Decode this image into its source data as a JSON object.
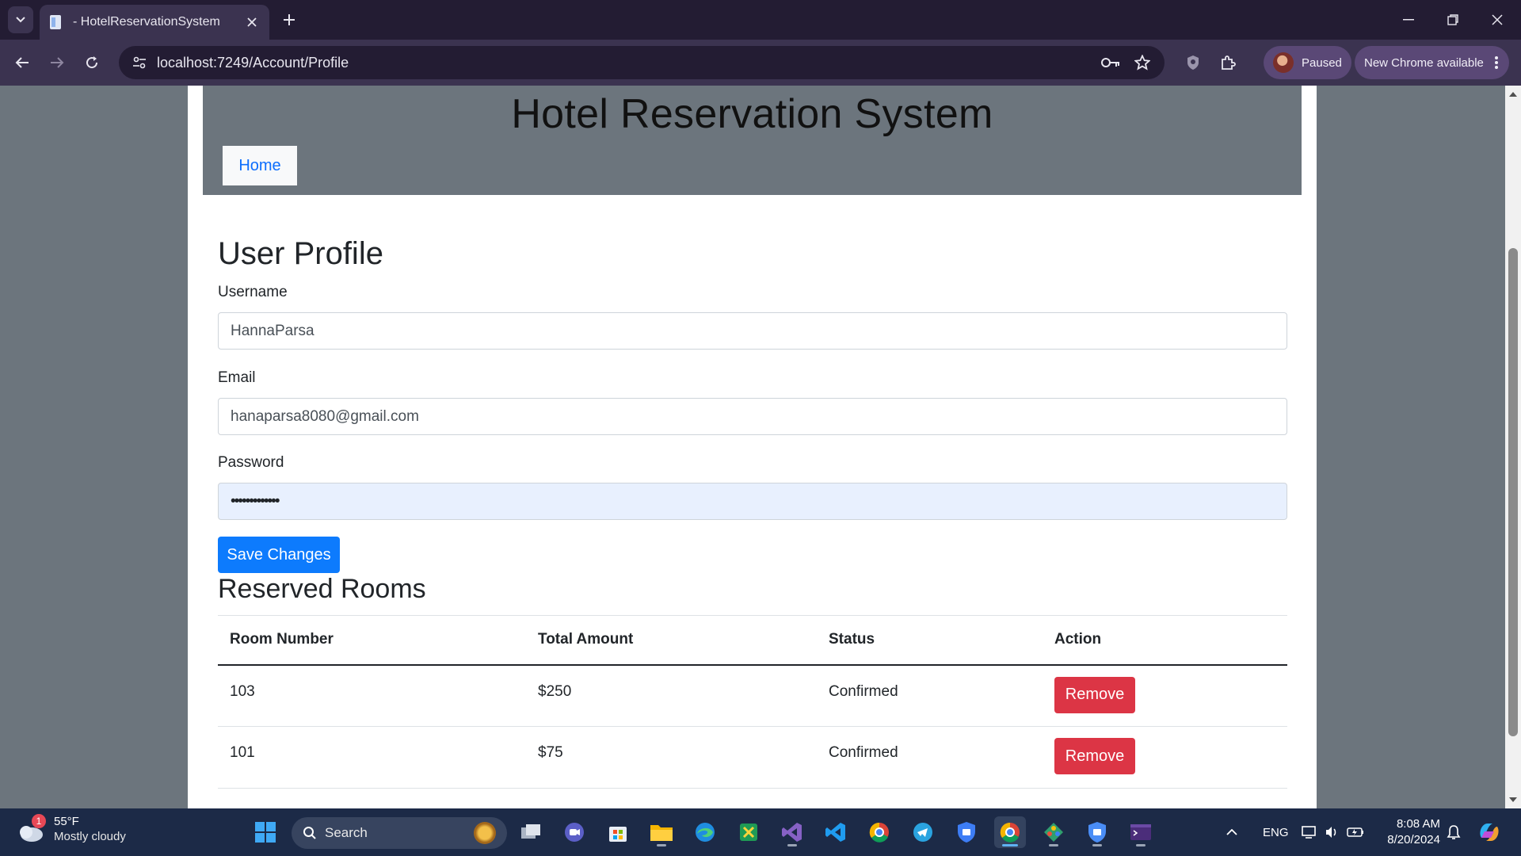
{
  "browser": {
    "tab": {
      "title": "- HotelReservationSystem"
    },
    "address_bar": {
      "url": "localhost:7249/Account/Profile"
    },
    "profile": {
      "status": "Paused"
    },
    "update_pill": {
      "label": "New Chrome available"
    }
  },
  "site": {
    "title": "Hotel Reservation System",
    "nav": {
      "home": "Home"
    }
  },
  "profile": {
    "heading": "User Profile",
    "username": {
      "label": "Username",
      "value": "HannaParsa"
    },
    "email": {
      "label": "Email",
      "value": "hanaparsa8080@gmail.com"
    },
    "password": {
      "label": "Password",
      "value": "•••••••••••••"
    },
    "save_label": "Save Changes"
  },
  "reservations": {
    "heading": "Reserved Rooms",
    "columns": [
      "Room Number",
      "Total Amount",
      "Status",
      "Action"
    ],
    "rows": [
      {
        "room": "103",
        "amount": "$250",
        "status": "Confirmed",
        "action": "Remove"
      },
      {
        "room": "101",
        "amount": "$75",
        "status": "Confirmed",
        "action": "Remove"
      }
    ]
  },
  "taskbar": {
    "weather": {
      "temp": "55°F",
      "condition": "Mostly cloudy",
      "badge": "1"
    },
    "search_placeholder": "Search",
    "language": "ENG",
    "time": "8:08 AM",
    "date": "8/20/2024",
    "apps": [
      "start-icon",
      "task-view-icon",
      "meet-icon",
      "store-icon",
      "file-explorer-icon",
      "edge-icon",
      "excel-app-icon",
      "visual-studio-icon",
      "vscode-icon",
      "chrome-icon",
      "telegram-icon",
      "vpn-shield-icon",
      "chrome-active-icon",
      "sourcetree-icon",
      "security-shield-icon",
      "terminal-icon"
    ]
  },
  "colors": {
    "header_bg": "#6c757d",
    "primary": "#0d7bfd",
    "danger": "#dc3545",
    "chrome_frame": "#231c33",
    "taskbar": "#1c2a47"
  }
}
